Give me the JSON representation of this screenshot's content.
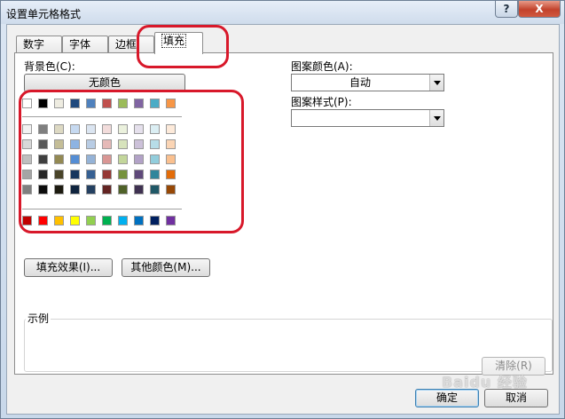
{
  "window": {
    "title": "设置单元格格式",
    "help_label": "?",
    "close_label": "X"
  },
  "tabs": [
    {
      "label": "数字"
    },
    {
      "label": "字体"
    },
    {
      "label": "边框"
    },
    {
      "label": "填充"
    }
  ],
  "fill": {
    "background_label": "背景色(C):",
    "no_color_label": "无颜色",
    "fill_effects_label": "填充效果(I)...",
    "more_colors_label": "其他颜色(M)...",
    "pattern_color_label": "图案颜色(A):",
    "pattern_color_value": "自动",
    "pattern_style_label": "图案样式(P):",
    "pattern_style_value": "",
    "sample_label": "示例"
  },
  "palette": {
    "theme_top": [
      "#ffffff",
      "#000000",
      "#eeece1",
      "#1f497d",
      "#4f81bd",
      "#c0504d",
      "#9bbb59",
      "#8064a2",
      "#4bacc6",
      "#f79646"
    ],
    "theme_tints": [
      [
        "#f2f2f2",
        "#7f7f7f",
        "#ddd9c3",
        "#c6d9f0",
        "#dbe5f1",
        "#f2dcdb",
        "#ebf1dd",
        "#e5e0ec",
        "#dbeef3",
        "#fdeada"
      ],
      [
        "#d8d8d8",
        "#595959",
        "#c4bd97",
        "#8db3e2",
        "#b8cce4",
        "#e5b9b7",
        "#d7e3bc",
        "#ccc1d9",
        "#b7dde8",
        "#fbd5b5"
      ],
      [
        "#bfbfbf",
        "#3f3f3f",
        "#938953",
        "#548dd4",
        "#95b3d7",
        "#d99694",
        "#c3d69b",
        "#b2a2c7",
        "#92cddc",
        "#fac08f"
      ],
      [
        "#a5a5a5",
        "#262626",
        "#494429",
        "#17365d",
        "#366092",
        "#953734",
        "#76923c",
        "#5f497a",
        "#31859b",
        "#e36c09"
      ],
      [
        "#7f7f7f",
        "#0c0c0c",
        "#1d1b10",
        "#0f243e",
        "#244061",
        "#632423",
        "#4f6128",
        "#3f3151",
        "#205867",
        "#974806"
      ]
    ],
    "standard": [
      "#c00000",
      "#ff0000",
      "#ffc000",
      "#ffff00",
      "#92d050",
      "#00b050",
      "#00b0f0",
      "#0070c0",
      "#002060",
      "#7030a0"
    ]
  },
  "footer": {
    "clear_label": "清除(R)",
    "ok_label": "确定",
    "cancel_label": "取消"
  },
  "watermark": "Baidu 经验",
  "annotation_color": "#d8182a"
}
